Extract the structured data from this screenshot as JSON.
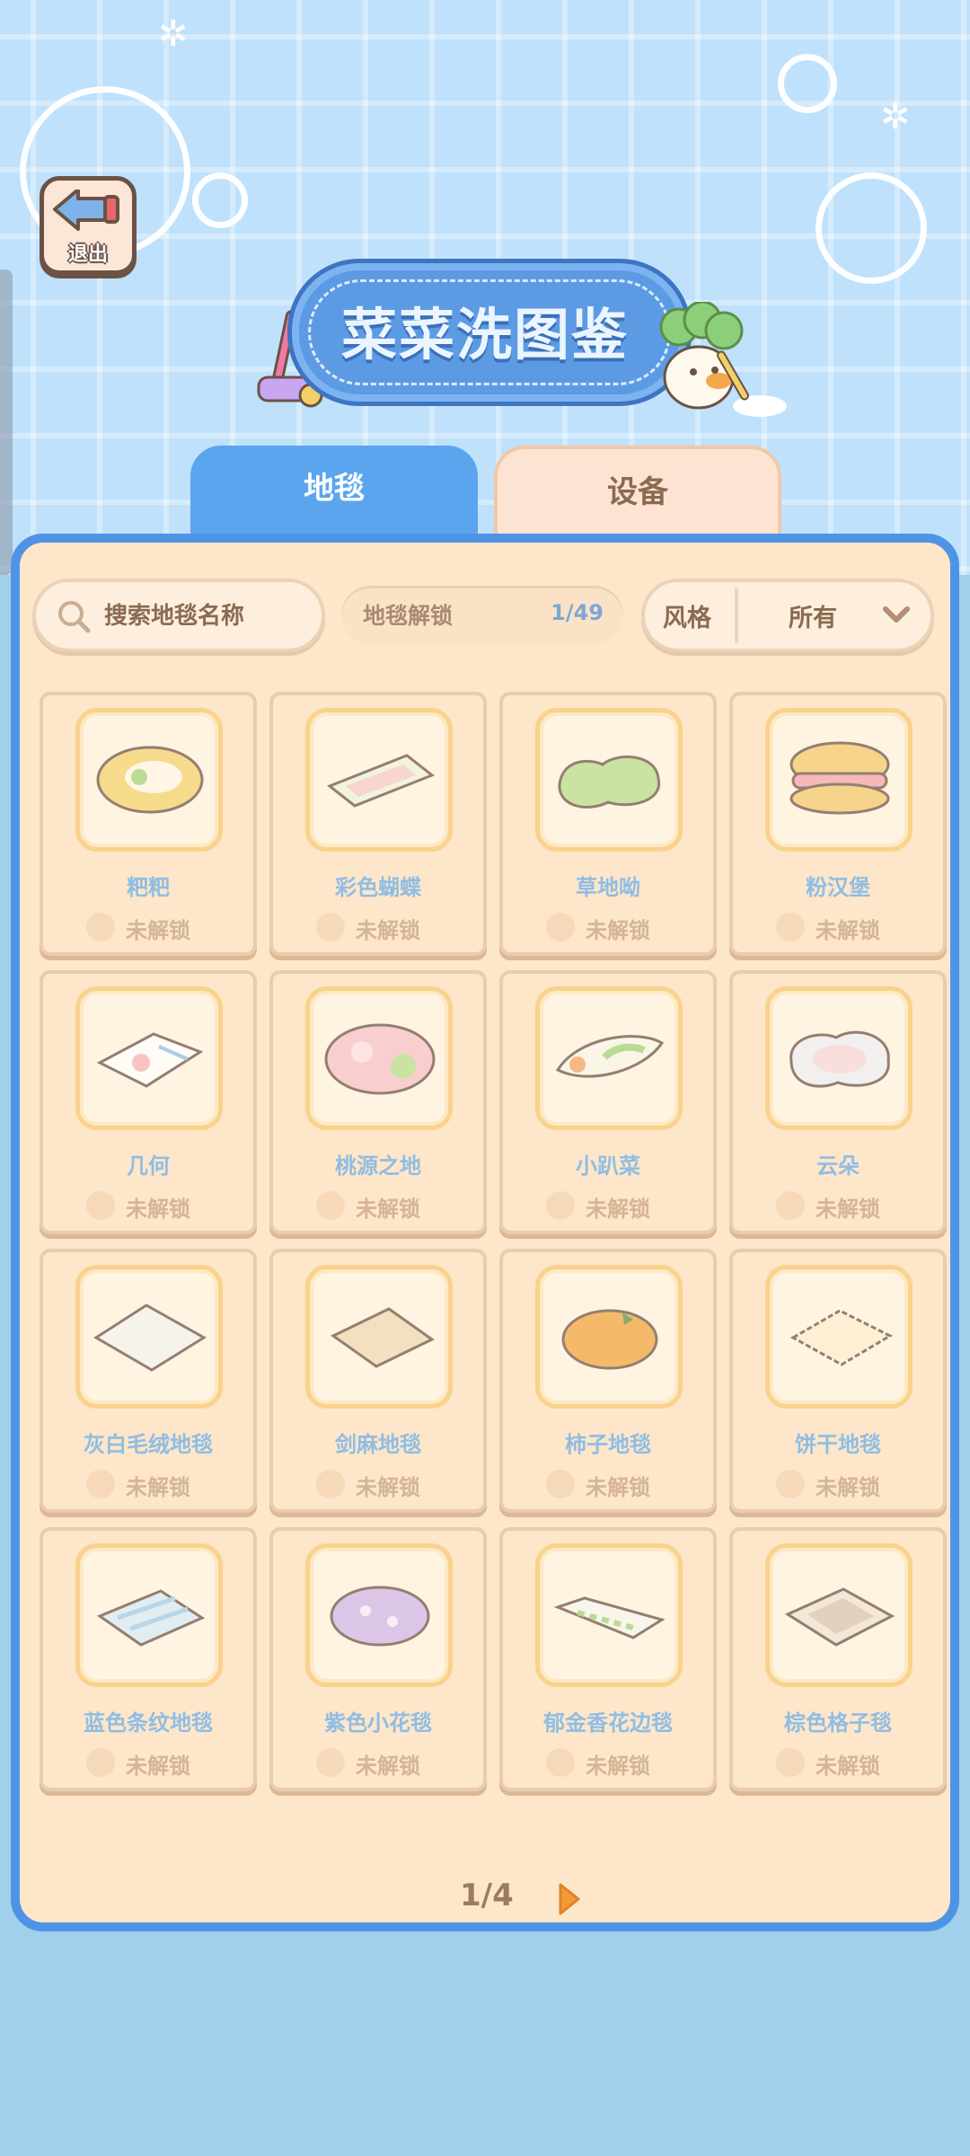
{
  "header": {
    "title": "菜菜洗图鉴",
    "exit_label": "退出"
  },
  "tabs": [
    {
      "label": "地毯",
      "active": true
    },
    {
      "label": "设备",
      "active": false
    }
  ],
  "filters": {
    "search_placeholder": "搜索地毯名称",
    "unlock_label": "地毯解锁",
    "unlock_count": "1/49",
    "style_label": "风格",
    "style_value": "所有"
  },
  "items": [
    {
      "name": "粑粑",
      "status": "未解锁",
      "shape": "blob-food"
    },
    {
      "name": "彩色蝴蝶",
      "status": "未解锁",
      "shape": "rect-rug"
    },
    {
      "name": "草地呦",
      "status": "未解锁",
      "shape": "green-blob"
    },
    {
      "name": "粉汉堡",
      "status": "未解锁",
      "shape": "burger"
    },
    {
      "name": "几何",
      "status": "未解锁",
      "shape": "geo"
    },
    {
      "name": "桃源之地",
      "status": "未解锁",
      "shape": "pink-blob"
    },
    {
      "name": "小趴菜",
      "status": "未解锁",
      "shape": "leaf"
    },
    {
      "name": "云朵",
      "status": "未解锁",
      "shape": "cloud"
    },
    {
      "name": "灰白毛绒地毯",
      "status": "未解锁",
      "shape": "diamond-white"
    },
    {
      "name": "剑麻地毯",
      "status": "未解锁",
      "shape": "diamond-beige"
    },
    {
      "name": "柿子地毯",
      "status": "未解锁",
      "shape": "persimmon"
    },
    {
      "name": "饼干地毯",
      "status": "未解锁",
      "shape": "cookie"
    },
    {
      "name": "蓝色条纹地毯",
      "status": "未解锁",
      "shape": "blue-stripe"
    },
    {
      "name": "紫色小花毯",
      "status": "未解锁",
      "shape": "purple-oval"
    },
    {
      "name": "郁金香花边毯",
      "status": "未解锁",
      "shape": "tulip"
    },
    {
      "name": "棕色格子毯",
      "status": "未解锁",
      "shape": "checker"
    }
  ],
  "pagination": {
    "label": "1/4"
  },
  "colors": {
    "accent_blue": "#5aa5ee",
    "panel_bg": "#fde6c9",
    "name_blue": "#8fbde4"
  }
}
